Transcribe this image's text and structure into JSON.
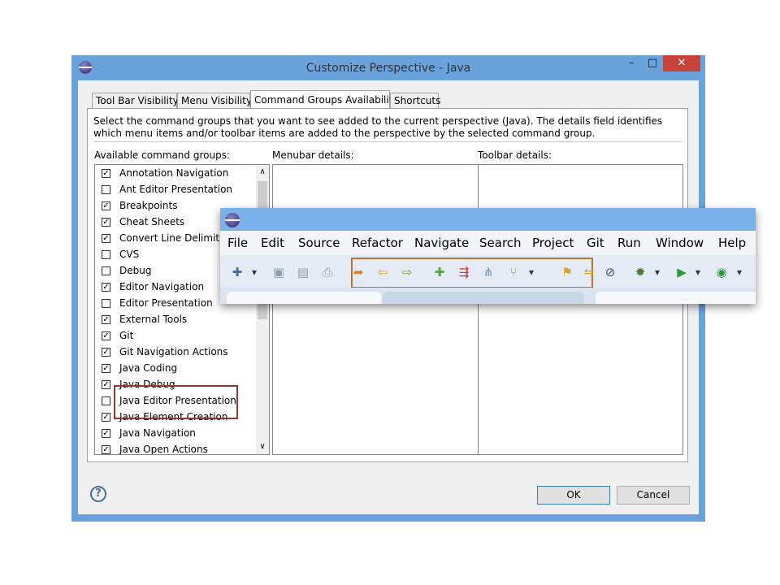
{
  "dialog": {
    "title": "Customize Perspective - Java",
    "min_glyph": "–",
    "max_glyph": "□",
    "close_glyph": "✕",
    "tabs": [
      {
        "label": "Tool Bar Visibility"
      },
      {
        "label": "Menu Visibility"
      },
      {
        "label": "Command Groups Availability"
      },
      {
        "label": "Shortcuts"
      }
    ],
    "description": "Select the command groups that you want to see added to the current perspective (Java).  The details field identifies which menu items and/or toolbar items are added to the perspective by the selected command group.",
    "available_label": "Available command groups:",
    "menubar_label": "Menubar details:",
    "toolbar_label": "Toolbar details:",
    "groups": [
      {
        "label": "Annotation Navigation",
        "checked": true
      },
      {
        "label": "Ant Editor Presentation",
        "checked": false
      },
      {
        "label": "Breakpoints",
        "checked": true
      },
      {
        "label": "Cheat Sheets",
        "checked": true
      },
      {
        "label": "Convert Line Delimiters",
        "checked": true
      },
      {
        "label": "CVS",
        "checked": false
      },
      {
        "label": "Debug",
        "checked": false
      },
      {
        "label": "Editor Navigation",
        "checked": true
      },
      {
        "label": "Editor Presentation",
        "checked": false
      },
      {
        "label": "External Tools",
        "checked": true
      },
      {
        "label": "Git",
        "checked": true
      },
      {
        "label": "Git Navigation Actions",
        "checked": true
      },
      {
        "label": "Java Coding",
        "checked": true
      },
      {
        "label": "Java Debug",
        "checked": true
      },
      {
        "label": "Java Editor Presentation",
        "checked": false
      },
      {
        "label": "Java Element Creation",
        "checked": true
      },
      {
        "label": "Java Navigation",
        "checked": true
      },
      {
        "label": "Java Open Actions",
        "checked": true
      }
    ],
    "check_glyph": "✓",
    "scroll_up_glyph": "∧",
    "scroll_down_glyph": "∨",
    "help_glyph": "?",
    "ok_label": "OK",
    "cancel_label": "Cancel"
  },
  "overlay": {
    "menu": [
      "File",
      "Edit",
      "Source",
      "Refactor",
      "Navigate",
      "Search",
      "Project",
      "Git",
      "Run",
      "Window",
      "Help"
    ],
    "toolbar_icons": [
      {
        "name": "new-wizard-icon",
        "glyph": "✚",
        "color": "#3a6fb0"
      },
      {
        "name": "dropdown-icon",
        "glyph": "▾",
        "color": "#333333"
      },
      {
        "name": "save-icon",
        "glyph": "▣",
        "color": "#8a9bb0"
      },
      {
        "name": "save-all-icon",
        "glyph": "▤",
        "color": "#8a9bb0"
      },
      {
        "name": "print-icon",
        "glyph": "⎙",
        "color": "#8a9bb0"
      },
      {
        "name": "git-commit-icon",
        "glyph": "➦",
        "color": "#d9822b"
      },
      {
        "name": "git-pull-icon",
        "glyph": "⇦",
        "color": "#d9a62b"
      },
      {
        "name": "git-push-icon",
        "glyph": "⇨",
        "color": "#7aa52b"
      },
      {
        "name": "git-add-icon",
        "glyph": "✚",
        "color": "#4ca832"
      },
      {
        "name": "git-fetch-icon",
        "glyph": "⇶",
        "color": "#d9342b"
      },
      {
        "name": "git-merge-icon",
        "glyph": "⋔",
        "color": "#6b8fb5"
      },
      {
        "name": "git-branch-icon",
        "glyph": "⑂",
        "color": "#9aa82b"
      },
      {
        "name": "dropdown-icon",
        "glyph": "▾",
        "color": "#333333"
      },
      {
        "name": "git-stash-icon",
        "glyph": "⚑",
        "color": "#d9a62b"
      },
      {
        "name": "git-rebase-icon",
        "glyph": "⇋",
        "color": "#d9a62b"
      },
      {
        "name": "skip-breakpoints-icon",
        "glyph": "⊘",
        "color": "#3a4f80"
      },
      {
        "name": "debug-icon",
        "glyph": "✹",
        "color": "#4a7a3a"
      },
      {
        "name": "dropdown-icon",
        "glyph": "▾",
        "color": "#333333"
      },
      {
        "name": "run-icon",
        "glyph": "▶",
        "color": "#2e9a3a"
      },
      {
        "name": "dropdown-icon",
        "glyph": "▾",
        "color": "#333333"
      },
      {
        "name": "external-tools-icon",
        "glyph": "◉",
        "color": "#2e9a3a"
      },
      {
        "name": "dropdown-icon",
        "glyph": "▾",
        "color": "#333333"
      }
    ]
  },
  "colors": {
    "title_bar": "#6aa3dc",
    "close_button": "#c8423c",
    "highlight_group": "#8b3a2f",
    "highlight_toolbar": "#b87333"
  }
}
